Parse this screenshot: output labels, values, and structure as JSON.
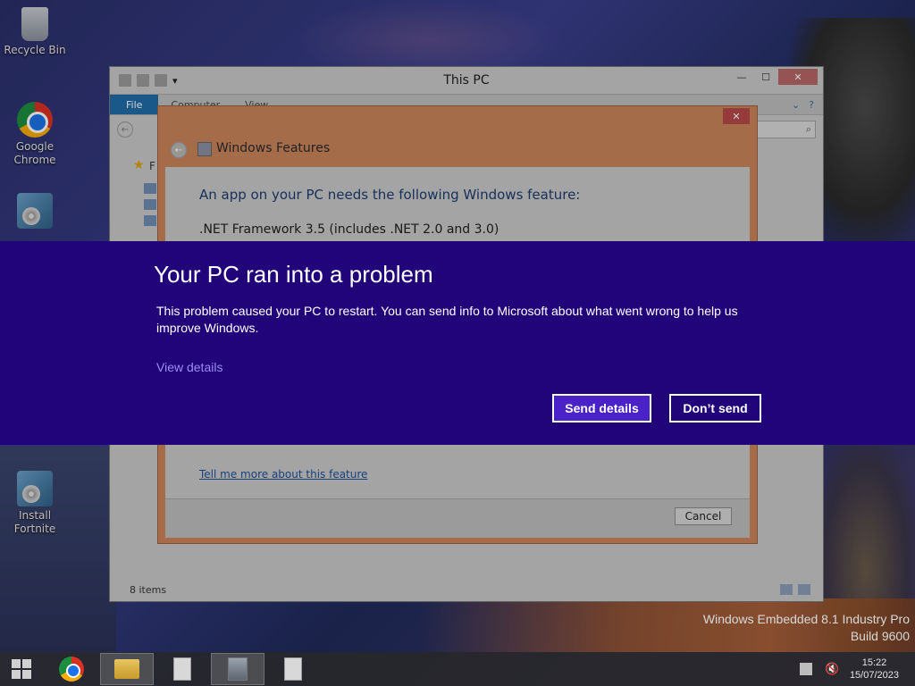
{
  "desktop": {
    "icons": [
      {
        "label": "Recycle Bin"
      },
      {
        "label": "Google\nChrome"
      },
      {
        "label": "Install\nFortnite"
      }
    ]
  },
  "explorer": {
    "title": "This PC",
    "ribbon": {
      "file": "File",
      "computer": "Computer",
      "view": "View"
    },
    "nav_letter": "F",
    "status": "8 items"
  },
  "features": {
    "title": "Windows Features",
    "message": "An app on your PC needs the following Windows feature:",
    "feature_name": ".NET Framework 3.5 (includes .NET 2.0 and 3.0)",
    "link": "Tell me more about this feature",
    "cancel": "Cancel"
  },
  "error": {
    "title": "Your PC ran into a problem",
    "description": "This problem caused your PC to restart. You can send info to Microsoft about what went wrong to help us improve Windows.",
    "view_details": "View details",
    "send": "Send details",
    "dont_send": "Don’t send",
    "accent": "#21037a"
  },
  "watermark": {
    "line1": "Windows Embedded 8.1 Industry Pro",
    "line2": "Build 9600"
  },
  "taskbar": {
    "time": "15:22",
    "date": "15/07/2023"
  }
}
